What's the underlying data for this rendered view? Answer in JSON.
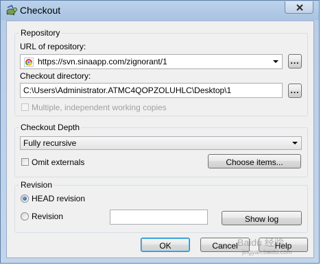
{
  "window": {
    "title": "Checkout",
    "close_icon": "close-icon"
  },
  "repository": {
    "group_title": "Repository",
    "url_label": "URL of repository:",
    "url_value": "https://svn.sinaapp.com/zignorant/1",
    "browse_label": "...",
    "checkout_dir_label": "Checkout directory:",
    "checkout_dir_value": "C:\\Users\\Administrator.ATMC4QOPZOLUHLC\\Desktop\\1",
    "dir_browse_label": "...",
    "multiple_wc_label": "Multiple, independent working copies",
    "multiple_wc_checked": false,
    "multiple_wc_enabled": false
  },
  "depth": {
    "group_title": "Checkout Depth",
    "selected": "Fully recursive",
    "omit_externals_label": "Omit externals",
    "omit_externals_checked": false,
    "choose_items_label": "Choose items..."
  },
  "revision": {
    "group_title": "Revision",
    "head_label": "HEAD revision",
    "head_selected": true,
    "revision_label": "Revision",
    "revision_selected": false,
    "revision_value": "",
    "show_log_label": "Show log"
  },
  "footer": {
    "ok_label": "OK",
    "cancel_label": "Cancel",
    "help_label": "Help"
  },
  "watermark": {
    "text": "Baidu 经验",
    "sub": "jingyan.baidu.com"
  }
}
